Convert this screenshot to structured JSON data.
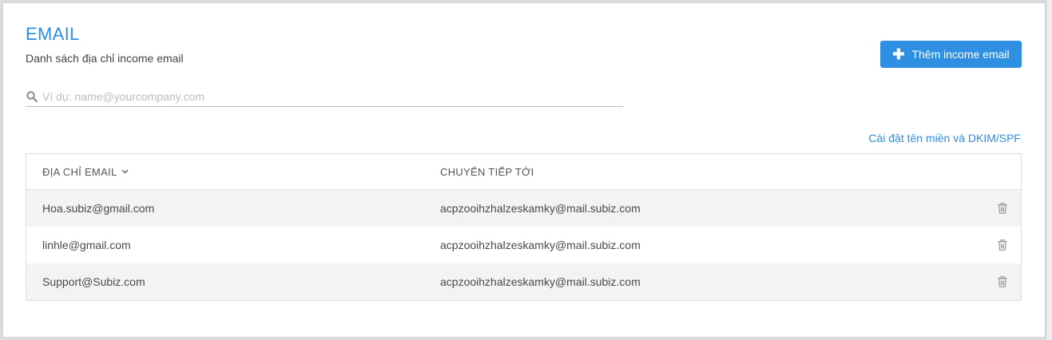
{
  "header": {
    "title": "EMAIL",
    "subtitle": "Danh sách địa chỉ income email",
    "add_button_label": "Thêm income email"
  },
  "search": {
    "placeholder": "Ví dụ: name@yourcompany.com",
    "value": ""
  },
  "domain_link_label": "Cài đặt tên miền và DKIM/SPF",
  "table": {
    "columns": [
      "ĐỊA CHỈ EMAIL",
      "CHUYỂN TIẾP TỚI"
    ],
    "rows": [
      {
        "email": "Hoa.subiz@gmail.com",
        "forward": "acpzooihzhalzeskamky@mail.subiz.com"
      },
      {
        "email": "linhle@gmail.com",
        "forward": "acpzooihzhalzeskamky@mail.subiz.com"
      },
      {
        "email": "Support@Subiz.com",
        "forward": "acpzooihzhalzeskamky@mail.subiz.com"
      }
    ]
  },
  "icons": {
    "search": "search-icon",
    "add": "plus-icon",
    "sort": "chevron-down-icon",
    "delete": "trash-icon"
  },
  "colors": {
    "accent": "#2d8ee6",
    "button": "#2f8fe3",
    "row_alt": "#f3f3f3"
  }
}
